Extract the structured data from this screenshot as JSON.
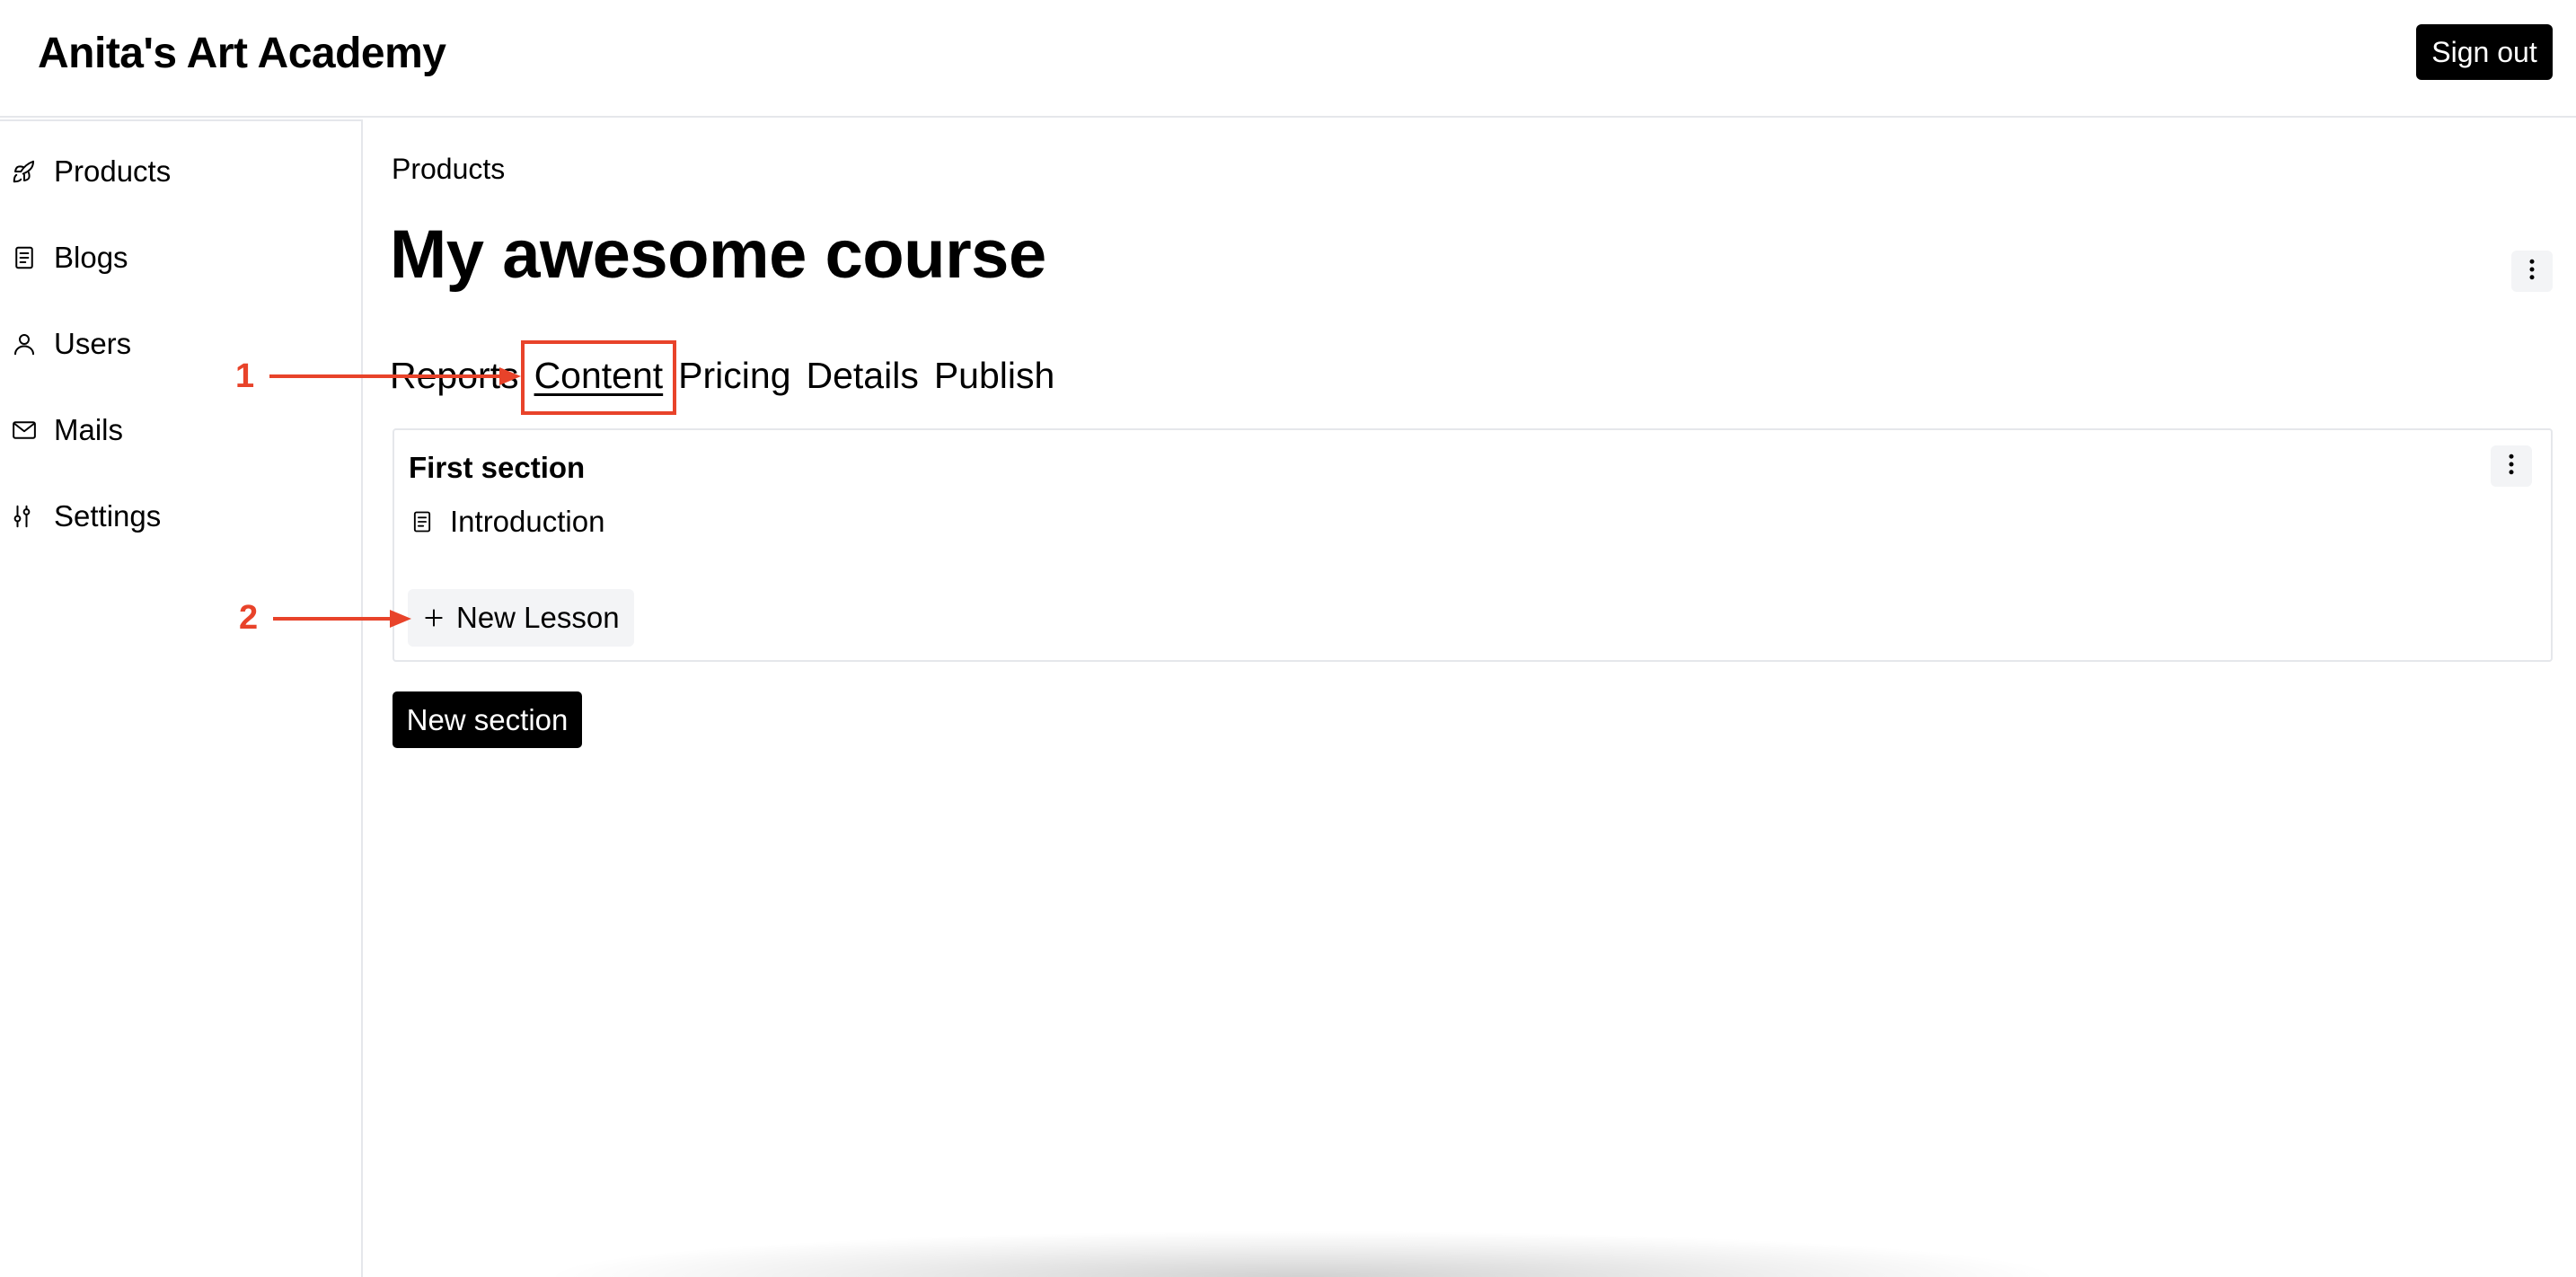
{
  "header": {
    "app_title": "Anita's Art Academy",
    "signout_label": "Sign out"
  },
  "sidebar": {
    "items": [
      {
        "label": "Products",
        "icon": "rocket-icon"
      },
      {
        "label": "Blogs",
        "icon": "document-icon"
      },
      {
        "label": "Users",
        "icon": "user-icon"
      },
      {
        "label": "Mails",
        "icon": "mail-icon"
      },
      {
        "label": "Settings",
        "icon": "sliders-icon"
      }
    ]
  },
  "main": {
    "breadcrumb": "Products",
    "title": "My awesome course",
    "tabs": [
      {
        "label": "Reports",
        "active": false
      },
      {
        "label": "Content",
        "active": true
      },
      {
        "label": "Pricing",
        "active": false
      },
      {
        "label": "Details",
        "active": false
      },
      {
        "label": "Publish",
        "active": false
      }
    ],
    "section": {
      "title": "First section",
      "lessons": [
        {
          "label": "Introduction",
          "icon": "document-icon"
        }
      ],
      "new_lesson_label": "New Lesson"
    },
    "new_section_label": "New section"
  },
  "annotations": {
    "callout_1": "1",
    "callout_2": "2",
    "color": "#e8432a"
  }
}
